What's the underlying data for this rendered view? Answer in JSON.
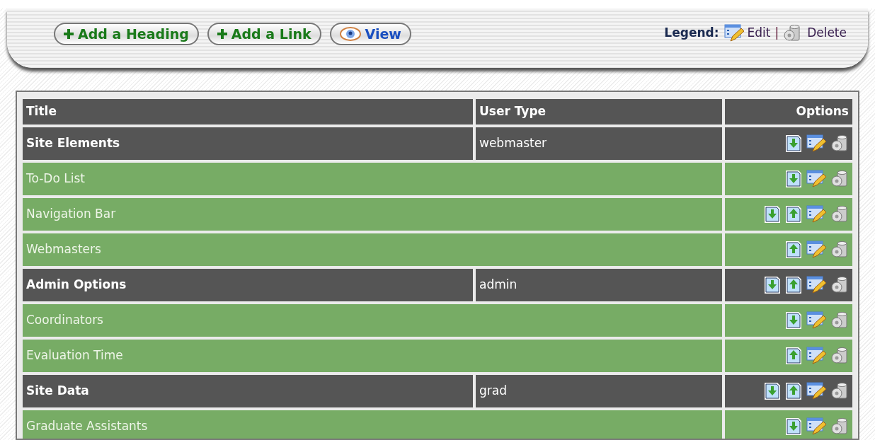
{
  "toolbar": {
    "buttons": [
      {
        "kind": "add",
        "label": "Add a Heading"
      },
      {
        "kind": "add",
        "label": "Add a Link"
      },
      {
        "kind": "view",
        "label": "View"
      }
    ],
    "legend": {
      "label": "Legend:",
      "edit": "Edit",
      "separator": "|",
      "delete": "Delete"
    }
  },
  "table": {
    "columns": [
      "Title",
      "User Type",
      "Options"
    ],
    "rows": [
      {
        "kind": "heading",
        "title": "Site Elements",
        "user_type": "webmaster",
        "move_down": true,
        "move_up": false
      },
      {
        "kind": "item",
        "title": "To-Do List",
        "move_down": true,
        "move_up": false
      },
      {
        "kind": "item",
        "title": "Navigation Bar",
        "move_down": true,
        "move_up": true
      },
      {
        "kind": "item",
        "title": "Webmasters",
        "move_down": false,
        "move_up": true
      },
      {
        "kind": "heading",
        "title": "Admin Options",
        "user_type": "admin",
        "move_down": true,
        "move_up": true
      },
      {
        "kind": "item",
        "title": "Coordinators",
        "move_down": true,
        "move_up": false
      },
      {
        "kind": "item",
        "title": "Evaluation Time",
        "move_down": false,
        "move_up": true
      },
      {
        "kind": "heading",
        "title": "Site Data",
        "user_type": "grad",
        "move_down": true,
        "move_up": true
      },
      {
        "kind": "item",
        "title": "Graduate Assistants",
        "move_down": true,
        "move_up": false
      }
    ]
  }
}
